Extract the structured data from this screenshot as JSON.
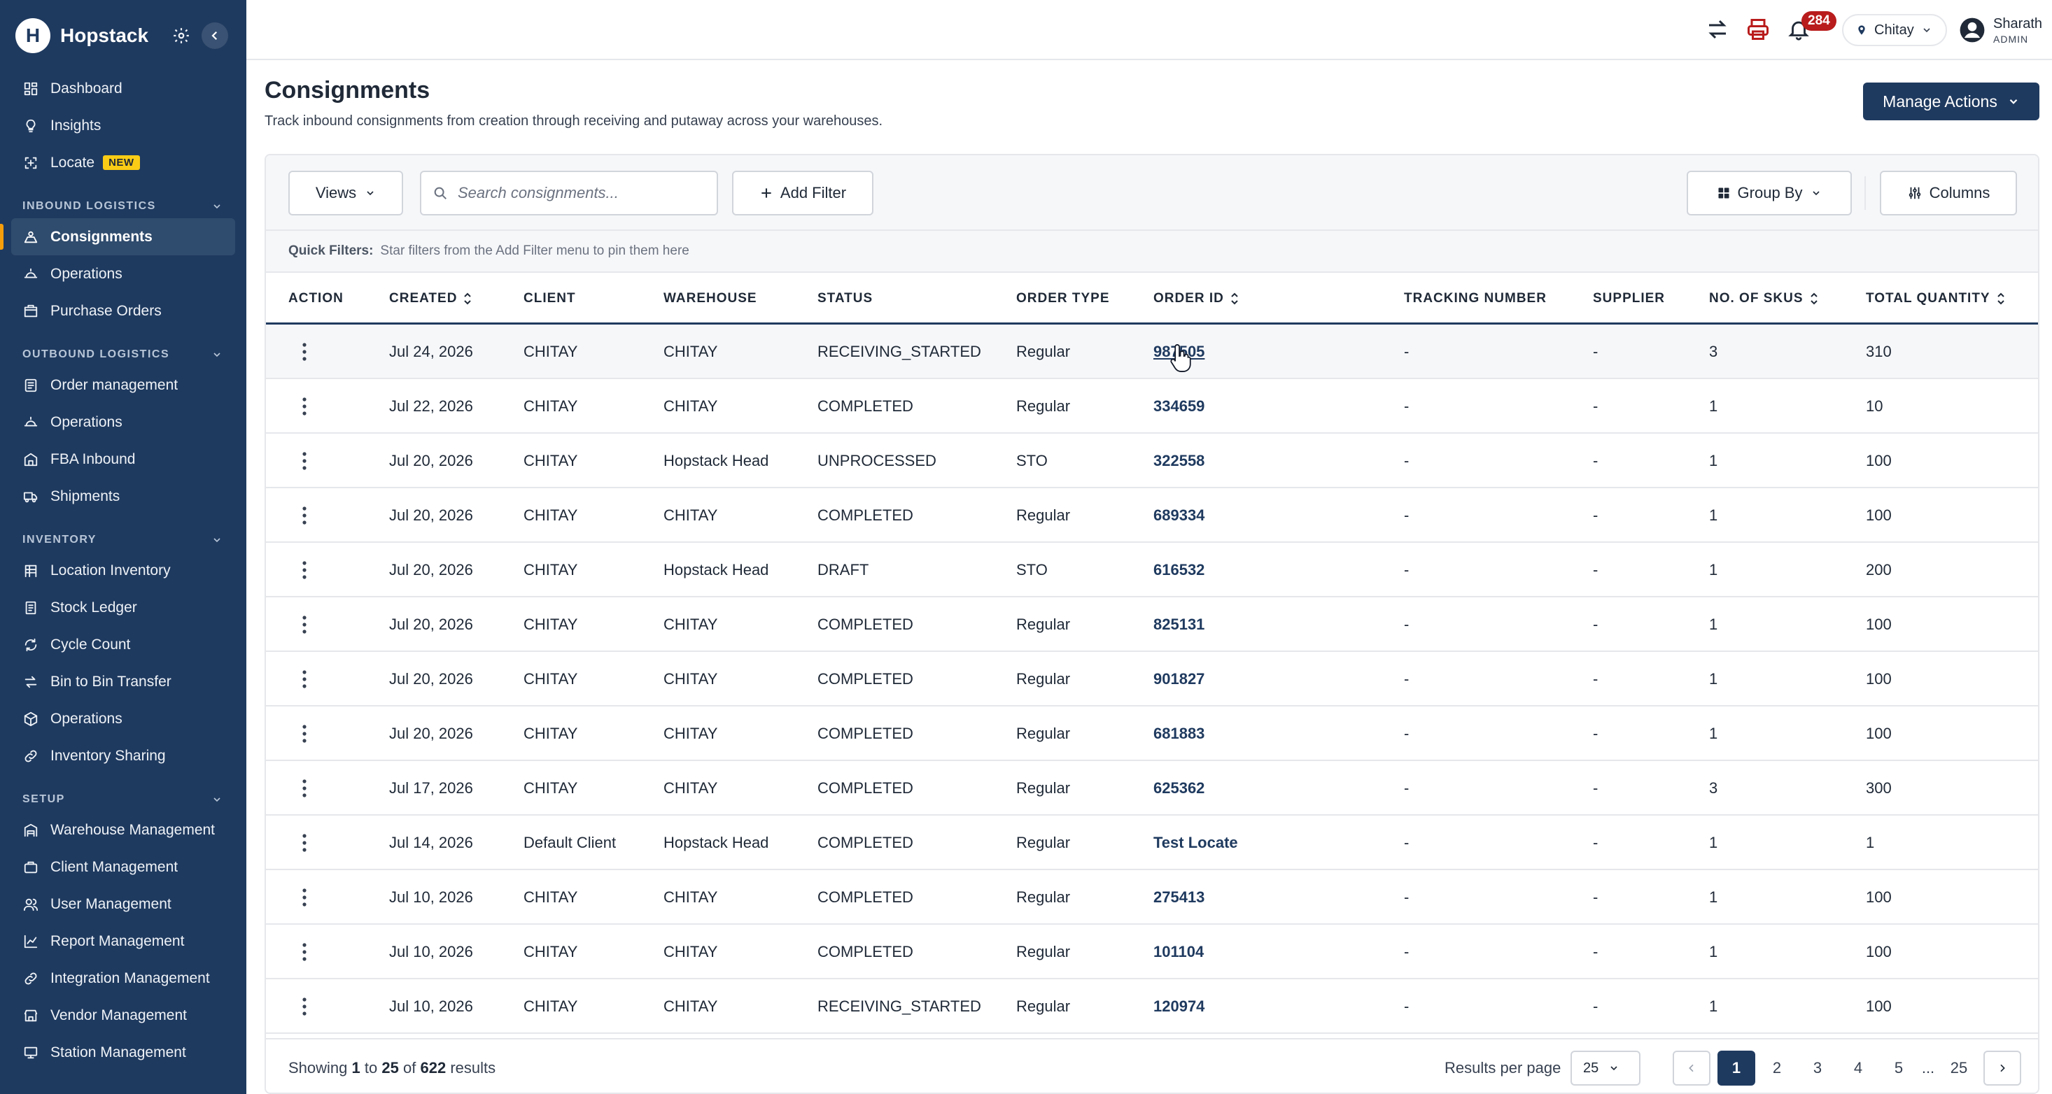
{
  "brand": {
    "name": "Hopstack"
  },
  "sidebar": {
    "top_items": [
      {
        "label": "Dashboard",
        "icon": "dashboard-icon"
      },
      {
        "label": "Insights",
        "icon": "lightbulb-icon"
      },
      {
        "label": "Locate",
        "icon": "scan-icon",
        "badge": "NEW"
      }
    ],
    "sections": [
      {
        "title": "INBOUND LOGISTICS",
        "items": [
          {
            "label": "Consignments",
            "icon": "consignment-icon",
            "active": true
          },
          {
            "label": "Operations",
            "icon": "operations-icon"
          },
          {
            "label": "Purchase Orders",
            "icon": "purchase-order-icon"
          }
        ]
      },
      {
        "title": "OUTBOUND LOGISTICS",
        "items": [
          {
            "label": "Order management",
            "icon": "orders-icon"
          },
          {
            "label": "Operations",
            "icon": "operations-icon"
          },
          {
            "label": "FBA Inbound",
            "icon": "fba-icon"
          },
          {
            "label": "Shipments",
            "icon": "truck-icon"
          }
        ]
      },
      {
        "title": "INVENTORY",
        "items": [
          {
            "label": "Location Inventory",
            "icon": "location-inventory-icon"
          },
          {
            "label": "Stock Ledger",
            "icon": "ledger-icon"
          },
          {
            "label": "Cycle Count",
            "icon": "cycle-icon"
          },
          {
            "label": "Bin to Bin Transfer",
            "icon": "transfer-icon"
          },
          {
            "label": "Operations",
            "icon": "cube-icon"
          },
          {
            "label": "Inventory Sharing",
            "icon": "link-icon"
          }
        ]
      },
      {
        "title": "SETUP",
        "items": [
          {
            "label": "Warehouse Management",
            "icon": "warehouse-icon"
          },
          {
            "label": "Client Management",
            "icon": "client-icon"
          },
          {
            "label": "User Management",
            "icon": "users-icon"
          },
          {
            "label": "Report Management",
            "icon": "chart-icon"
          },
          {
            "label": "Integration Management",
            "icon": "integration-icon"
          },
          {
            "label": "Vendor Management",
            "icon": "vendor-icon"
          },
          {
            "label": "Station Management",
            "icon": "station-icon"
          }
        ]
      }
    ]
  },
  "topbar": {
    "notification_count": "284",
    "warehouse": "Chitay",
    "user_name": "Sharath",
    "user_role": "ADMIN"
  },
  "page": {
    "title": "Consignments",
    "subtitle": "Track inbound consignments from creation through receiving and putaway across your warehouses.",
    "manage_actions": "Manage Actions"
  },
  "toolbar": {
    "views": "Views",
    "search_placeholder": "Search consignments...",
    "add_filter": "Add Filter",
    "group_by": "Group By",
    "columns": "Columns",
    "quick_filters_label": "Quick Filters:",
    "quick_filters_hint": "Star filters from the Add Filter menu to pin them here"
  },
  "table": {
    "headers": [
      "ACTION",
      "CREATED",
      "CLIENT",
      "WAREHOUSE",
      "STATUS",
      "ORDER TYPE",
      "ORDER ID",
      "TRACKING NUMBER",
      "SUPPLIER",
      "NO. OF SKUS",
      "TOTAL QUANTITY"
    ],
    "rows": [
      {
        "created": "Jul 24, 2026",
        "client": "CHITAY",
        "warehouse": "CHITAY",
        "status": "RECEIVING_STARTED",
        "order_type": "Regular",
        "order_id": "987505",
        "tracking": "-",
        "supplier": "-",
        "skus": "3",
        "qty": "310"
      },
      {
        "created": "Jul 22, 2026",
        "client": "CHITAY",
        "warehouse": "CHITAY",
        "status": "COMPLETED",
        "order_type": "Regular",
        "order_id": "334659",
        "tracking": "-",
        "supplier": "-",
        "skus": "1",
        "qty": "10"
      },
      {
        "created": "Jul 20, 2026",
        "client": "CHITAY",
        "warehouse": "Hopstack Head",
        "status": "UNPROCESSED",
        "order_type": "STO",
        "order_id": "322558",
        "tracking": "-",
        "supplier": "-",
        "skus": "1",
        "qty": "100"
      },
      {
        "created": "Jul 20, 2026",
        "client": "CHITAY",
        "warehouse": "CHITAY",
        "status": "COMPLETED",
        "order_type": "Regular",
        "order_id": "689334",
        "tracking": "-",
        "supplier": "-",
        "skus": "1",
        "qty": "100"
      },
      {
        "created": "Jul 20, 2026",
        "client": "CHITAY",
        "warehouse": "Hopstack Head",
        "status": "DRAFT",
        "order_type": "STO",
        "order_id": "616532",
        "tracking": "-",
        "supplier": "-",
        "skus": "1",
        "qty": "200"
      },
      {
        "created": "Jul 20, 2026",
        "client": "CHITAY",
        "warehouse": "CHITAY",
        "status": "COMPLETED",
        "order_type": "Regular",
        "order_id": "825131",
        "tracking": "-",
        "supplier": "-",
        "skus": "1",
        "qty": "100"
      },
      {
        "created": "Jul 20, 2026",
        "client": "CHITAY",
        "warehouse": "CHITAY",
        "status": "COMPLETED",
        "order_type": "Regular",
        "order_id": "901827",
        "tracking": "-",
        "supplier": "-",
        "skus": "1",
        "qty": "100"
      },
      {
        "created": "Jul 20, 2026",
        "client": "CHITAY",
        "warehouse": "CHITAY",
        "status": "COMPLETED",
        "order_type": "Regular",
        "order_id": "681883",
        "tracking": "-",
        "supplier": "-",
        "skus": "1",
        "qty": "100"
      },
      {
        "created": "Jul 17, 2026",
        "client": "CHITAY",
        "warehouse": "CHITAY",
        "status": "COMPLETED",
        "order_type": "Regular",
        "order_id": "625362",
        "tracking": "-",
        "supplier": "-",
        "skus": "3",
        "qty": "300"
      },
      {
        "created": "Jul 14, 2026",
        "client": "Default Client",
        "warehouse": "Hopstack Head",
        "status": "COMPLETED",
        "order_type": "Regular",
        "order_id": "Test Locate",
        "tracking": "-",
        "supplier": "-",
        "skus": "1",
        "qty": "1"
      },
      {
        "created": "Jul 10, 2026",
        "client": "CHITAY",
        "warehouse": "CHITAY",
        "status": "COMPLETED",
        "order_type": "Regular",
        "order_id": "275413",
        "tracking": "-",
        "supplier": "-",
        "skus": "1",
        "qty": "100"
      },
      {
        "created": "Jul 10, 2026",
        "client": "CHITAY",
        "warehouse": "CHITAY",
        "status": "COMPLETED",
        "order_type": "Regular",
        "order_id": "101104",
        "tracking": "-",
        "supplier": "-",
        "skus": "1",
        "qty": "100"
      },
      {
        "created": "Jul 10, 2026",
        "client": "CHITAY",
        "warehouse": "CHITAY",
        "status": "RECEIVING_STARTED",
        "order_type": "Regular",
        "order_id": "120974",
        "tracking": "-",
        "supplier": "-",
        "skus": "1",
        "qty": "100"
      }
    ]
  },
  "footer": {
    "showing_prefix": "Showing",
    "from": "1",
    "to_word": "to",
    "to": "25",
    "of_word": "of",
    "total": "622",
    "results_word": "results",
    "results_per_page_label": "Results per page",
    "results_per_page": "25",
    "pages": [
      "1",
      "2",
      "3",
      "4",
      "5",
      "...",
      "25"
    ],
    "current_page": "1"
  },
  "colors": {
    "sidebar_bg": "#1f3a5f",
    "accent": "#1f3a5f",
    "badge_red": "#b91c1c",
    "new_badge": "#facc15"
  }
}
